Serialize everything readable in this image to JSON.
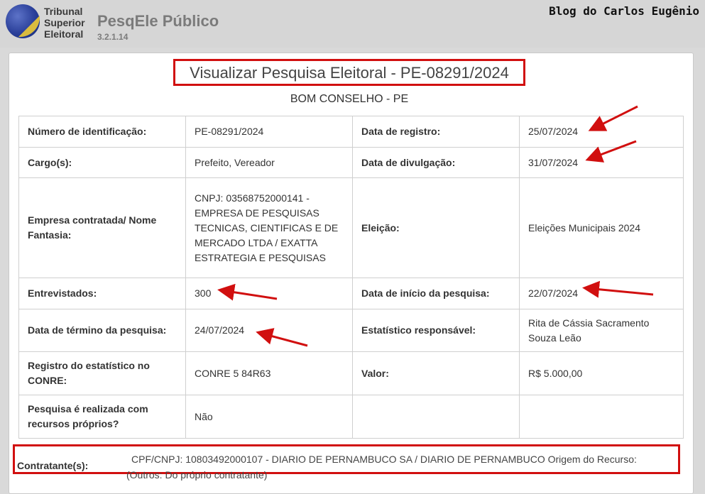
{
  "header": {
    "logo_lines": [
      "Tribunal",
      "Superior",
      "Eleitoral"
    ],
    "app_title": "PesqEle Público",
    "version": "3.2.1.14",
    "blog": "Blog do Carlos Eugênio"
  },
  "page": {
    "title": "Visualizar Pesquisa Eleitoral - PE-08291/2024",
    "subtitle": "BOM CONSELHO - PE"
  },
  "rows": {
    "numero_label": "Número de identificação:",
    "numero_value": "PE-08291/2024",
    "registro_label": "Data de registro:",
    "registro_value": "25/07/2024",
    "cargo_label": "Cargo(s):",
    "cargo_value": "Prefeito, Vereador",
    "divulgacao_label": "Data de divulgação:",
    "divulgacao_value": "31/07/2024",
    "empresa_label": "Empresa contratada/ Nome Fantasia:",
    "empresa_value": "CNPJ: 03568752000141 - EMPRESA DE PESQUISAS TECNICAS, CIENTIFICAS E DE MERCADO LTDA / EXATTA ESTRATEGIA E PESQUISAS",
    "eleicao_label": "Eleição:",
    "eleicao_value": "Eleições Municipais 2024",
    "entrevistados_label": "Entrevistados:",
    "entrevistados_value": "300",
    "inicio_label": "Data de início da pesquisa:",
    "inicio_value": "22/07/2024",
    "termino_label": "Data de término da pesquisa:",
    "termino_value": "24/07/2024",
    "estatistico_label": "Estatístico responsável:",
    "estatistico_value": "Rita de Cássia Sacramento Souza Leão",
    "conre_label": "Registro do estatístico no CONRE:",
    "conre_value": "CONRE 5 84R63",
    "valor_label": "Valor:",
    "valor_value": "R$ 5.000,00",
    "recursos_label": "Pesquisa é realizada com recursos próprios?",
    "recursos_value": "Não"
  },
  "contratante": {
    "label": "Contratante(s):",
    "line1": "CPF/CNPJ: 10803492000107 - DIARIO DE PERNAMBUCO SA / DIARIO DE PERNAMBUCO Origem do Recurso:",
    "line2": "(Outros: Do próprio contratante)"
  },
  "colors": {
    "highlight": "#d10f0f",
    "arrow": "#d10f0f"
  }
}
